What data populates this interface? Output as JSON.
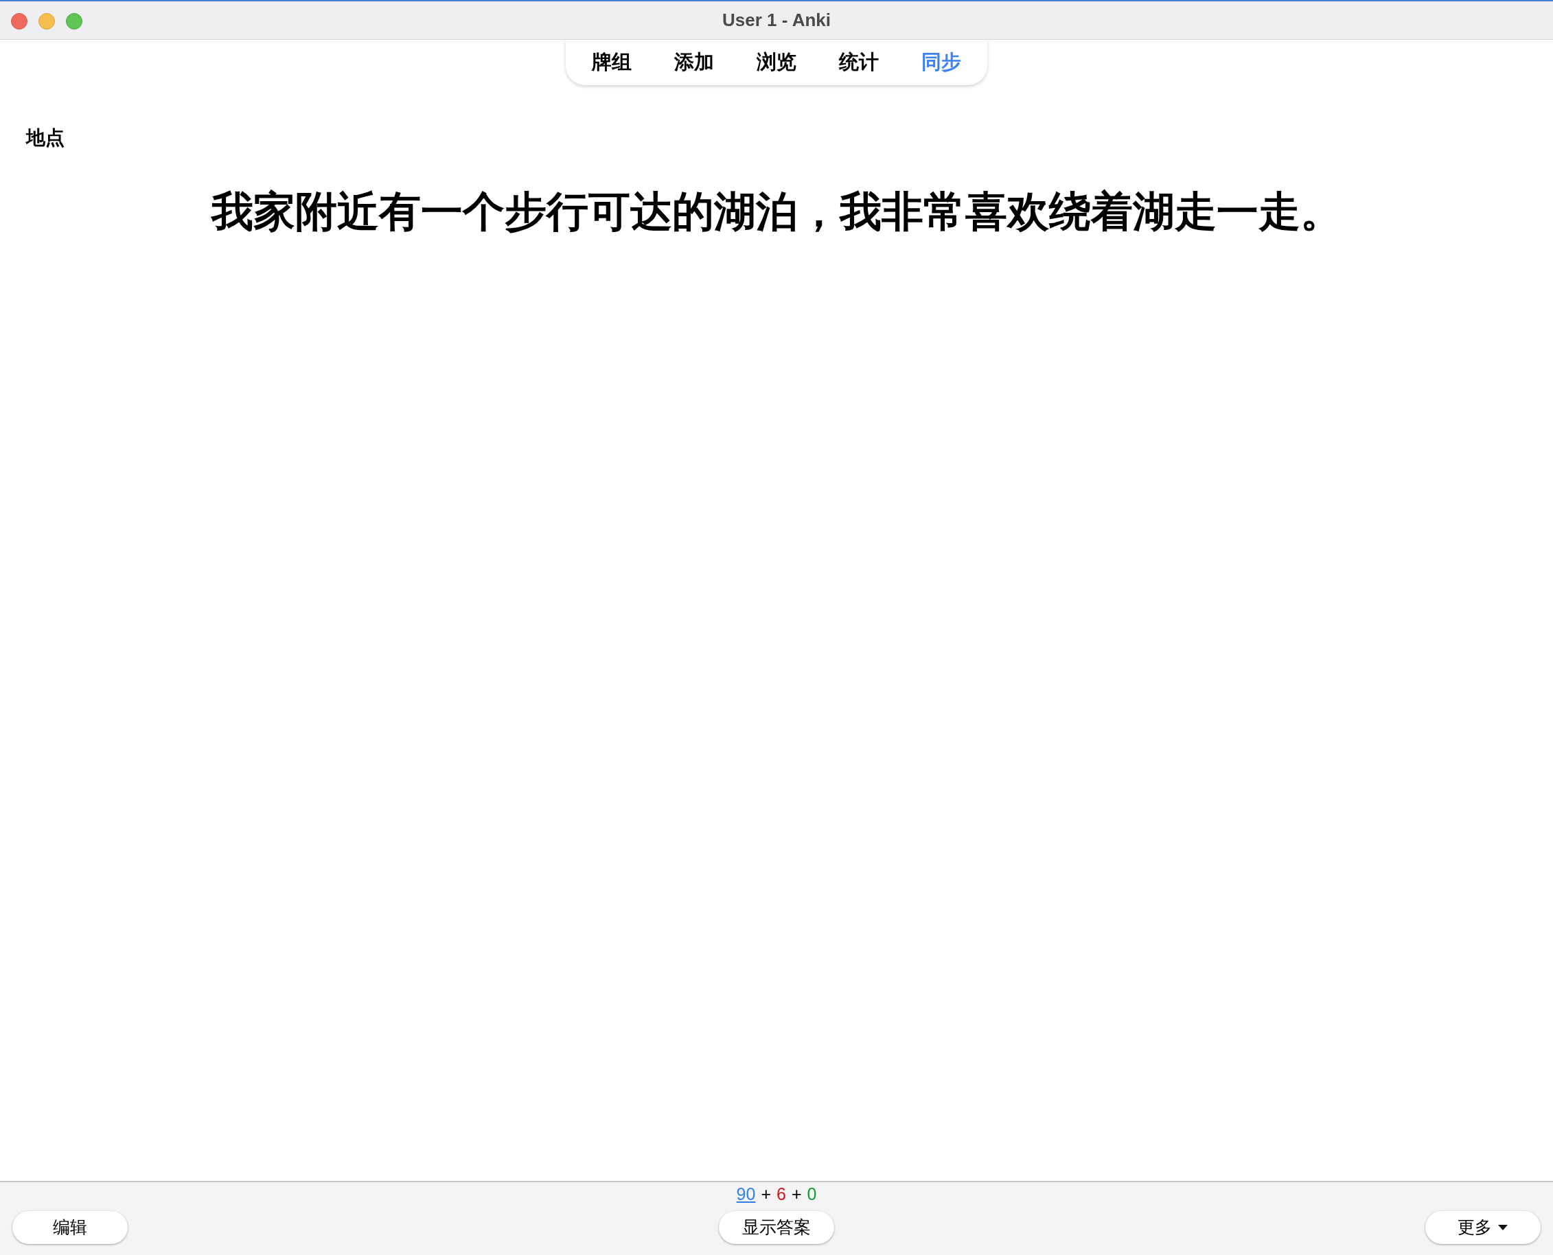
{
  "window": {
    "title": "User 1 - Anki"
  },
  "toolbar": [
    {
      "label": "牌组",
      "highlighted": false
    },
    {
      "label": "添加",
      "highlighted": false
    },
    {
      "label": "浏览",
      "highlighted": false
    },
    {
      "label": "统计",
      "highlighted": false
    },
    {
      "label": "同步",
      "highlighted": true
    }
  ],
  "card": {
    "field_label": "地点",
    "sentence": "我家附近有一个步行可达的湖泊，我非常喜欢绕着湖走一走。"
  },
  "bottom_bar": {
    "edit_button": "编辑",
    "counts": [
      {
        "value": "90",
        "color": "#2f7ff0",
        "underlined": true
      },
      {
        "value": "6",
        "color": "#d2161b",
        "underlined": false
      },
      {
        "value": "0",
        "color": "#0f9b32",
        "underlined": false
      }
    ],
    "separators": [
      "+",
      "+"
    ],
    "show_answer_button": "显示答案",
    "more_button": "更多"
  }
}
